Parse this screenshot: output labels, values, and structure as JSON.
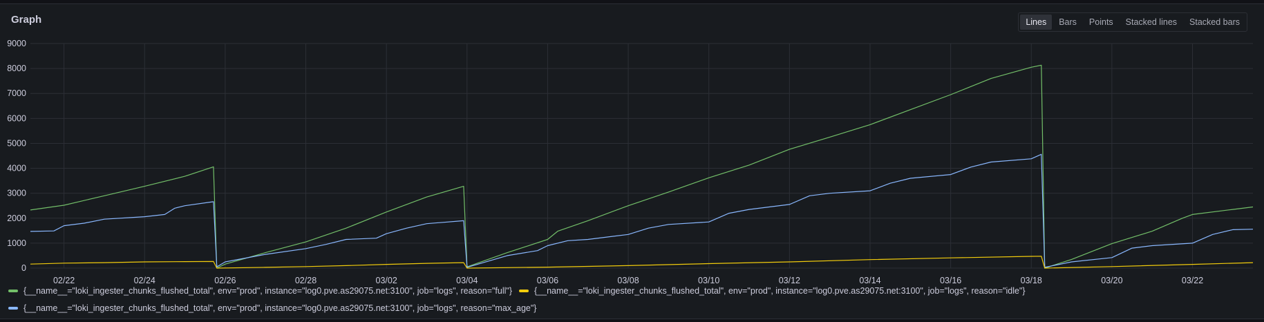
{
  "panel": {
    "title": "Graph",
    "view_modes": [
      "Lines",
      "Bars",
      "Points",
      "Stacked lines",
      "Stacked bars"
    ],
    "active_mode": "Lines"
  },
  "colors": {
    "background": "#181b1f",
    "grid": "#2c2f36",
    "full": "#73bf69",
    "idle": "#f2cc0c",
    "max_age": "#8ab8ff"
  },
  "legend": [
    {
      "key": "full",
      "label": "{__name__=\"loki_ingester_chunks_flushed_total\", env=\"prod\", instance=\"log0.pve.as29075.net:3100\", job=\"logs\", reason=\"full\"}"
    },
    {
      "key": "idle",
      "label": "{__name__=\"loki_ingester_chunks_flushed_total\", env=\"prod\", instance=\"log0.pve.as29075.net:3100\", job=\"logs\", reason=\"idle\"}"
    },
    {
      "key": "max_age",
      "label": "{__name__=\"loki_ingester_chunks_flushed_total\", env=\"prod\", instance=\"log0.pve.as29075.net:3100\", job=\"logs\", reason=\"max_age\"}"
    }
  ],
  "chart_data": {
    "type": "line",
    "title": "",
    "xlabel": "",
    "ylabel": "",
    "x_unit": "date (February–March)",
    "xlim": [
      "02/21 04:00",
      "03/23 12:00"
    ],
    "ylim": [
      0,
      9000
    ],
    "yticks": [
      0,
      1000,
      2000,
      3000,
      4000,
      5000,
      6000,
      7000,
      8000,
      9000
    ],
    "xticks": [
      "02/22",
      "02/24",
      "02/26",
      "02/28",
      "03/02",
      "03/04",
      "03/06",
      "03/08",
      "03/10",
      "03/12",
      "03/14",
      "03/16",
      "03/18",
      "03/20",
      "03/22"
    ],
    "grid": true,
    "legend_position": "bottom",
    "series": [
      {
        "key": "full",
        "segments": [
          [
            [
              "02/21 04:00",
              2330
            ],
            [
              "02/22 00:00",
              2520
            ],
            [
              "02/23 00:00",
              2900
            ],
            [
              "02/24 00:00",
              3280
            ],
            [
              "02/25 00:00",
              3680
            ],
            [
              "02/25 17:00",
              4060
            ]
          ],
          [
            [
              "02/25 19:00",
              0
            ],
            [
              "02/26 00:00",
              160
            ],
            [
              "02/27 00:00",
              620
            ],
            [
              "02/28 00:00",
              1050
            ],
            [
              "03/01 00:00",
              1600
            ],
            [
              "03/02 00:00",
              2250
            ],
            [
              "03/03 00:00",
              2850
            ],
            [
              "03/03 22:00",
              3280
            ]
          ],
          [
            [
              "03/04 00:00",
              50
            ],
            [
              "03/05 00:00",
              620
            ],
            [
              "03/06 00:00",
              1150
            ],
            [
              "03/06 06:00",
              1480
            ],
            [
              "03/07 00:00",
              1900
            ],
            [
              "03/08 00:00",
              2500
            ],
            [
              "03/09 00:00",
              3050
            ],
            [
              "03/10 00:00",
              3620
            ],
            [
              "03/11 00:00",
              4130
            ],
            [
              "03/12 00:00",
              4760
            ],
            [
              "03/13 00:00",
              5250
            ],
            [
              "03/14 00:00",
              5750
            ],
            [
              "03/15 00:00",
              6350
            ],
            [
              "03/16 00:00",
              6950
            ],
            [
              "03/17 00:00",
              7600
            ],
            [
              "03/18 00:00",
              8050
            ],
            [
              "03/18 06:00",
              8130
            ]
          ],
          [
            [
              "03/18 08:00",
              0
            ],
            [
              "03/19 00:00",
              350
            ],
            [
              "03/20 00:00",
              980
            ],
            [
              "03/21 00:00",
              1480
            ],
            [
              "03/21 18:00",
              2000
            ],
            [
              "03/22 00:00",
              2150
            ],
            [
              "03/23 00:00",
              2350
            ],
            [
              "03/23 12:00",
              2450
            ]
          ]
        ]
      },
      {
        "key": "max_age",
        "segments": [
          [
            [
              "02/21 04:00",
              1470
            ],
            [
              "02/21 18:00",
              1490
            ],
            [
              "02/22 00:00",
              1700
            ],
            [
              "02/22 12:00",
              1800
            ],
            [
              "02/23 00:00",
              1960
            ],
            [
              "02/24 00:00",
              2060
            ],
            [
              "02/24 12:00",
              2150
            ],
            [
              "02/24 18:00",
              2400
            ],
            [
              "02/25 00:00",
              2500
            ],
            [
              "02/25 17:00",
              2660
            ]
          ],
          [
            [
              "02/25 19:00",
              50
            ],
            [
              "02/26 00:00",
              250
            ],
            [
              "02/27 00:00",
              550
            ],
            [
              "02/28 00:00",
              780
            ],
            [
              "02/28 12:00",
              950
            ],
            [
              "03/01 00:00",
              1150
            ],
            [
              "03/01 18:00",
              1200
            ],
            [
              "03/02 00:00",
              1380
            ],
            [
              "03/02 12:00",
              1600
            ],
            [
              "03/03 00:00",
              1780
            ],
            [
              "03/03 22:00",
              1900
            ]
          ],
          [
            [
              "03/04 00:00",
              30
            ],
            [
              "03/05 00:00",
              500
            ],
            [
              "03/05 18:00",
              700
            ],
            [
              "03/06 00:00",
              900
            ],
            [
              "03/06 12:00",
              1100
            ],
            [
              "03/07 00:00",
              1150
            ],
            [
              "03/08 00:00",
              1350
            ],
            [
              "03/08 12:00",
              1600
            ],
            [
              "03/09 00:00",
              1750
            ],
            [
              "03/10 00:00",
              1850
            ],
            [
              "03/10 12:00",
              2200
            ],
            [
              "03/11 00:00",
              2350
            ],
            [
              "03/12 00:00",
              2550
            ],
            [
              "03/12 12:00",
              2900
            ],
            [
              "03/13 00:00",
              3000
            ],
            [
              "03/14 00:00",
              3100
            ],
            [
              "03/14 12:00",
              3400
            ],
            [
              "03/15 00:00",
              3600
            ],
            [
              "03/16 00:00",
              3750
            ],
            [
              "03/16 12:00",
              4050
            ],
            [
              "03/17 00:00",
              4250
            ],
            [
              "03/18 00:00",
              4380
            ],
            [
              "03/18 06:00",
              4560
            ]
          ],
          [
            [
              "03/18 08:00",
              30
            ],
            [
              "03/19 00:00",
              250
            ],
            [
              "03/20 00:00",
              420
            ],
            [
              "03/20 12:00",
              800
            ],
            [
              "03/21 00:00",
              900
            ],
            [
              "03/22 00:00",
              1000
            ],
            [
              "03/22 12:00",
              1350
            ],
            [
              "03/23 00:00",
              1540
            ],
            [
              "03/23 12:00",
              1560
            ]
          ]
        ]
      },
      {
        "key": "idle",
        "segments": [
          [
            [
              "02/21 04:00",
              160
            ],
            [
              "02/22 00:00",
              200
            ],
            [
              "02/23 00:00",
              220
            ],
            [
              "02/24 00:00",
              250
            ],
            [
              "02/25 00:00",
              260
            ],
            [
              "02/25 17:00",
              265
            ]
          ],
          [
            [
              "02/25 19:00",
              0
            ],
            [
              "02/27 00:00",
              30
            ],
            [
              "02/28 00:00",
              60
            ],
            [
              "03/01 00:00",
              100
            ],
            [
              "03/02 00:00",
              150
            ],
            [
              "03/03 00:00",
              190
            ],
            [
              "03/03 22:00",
              220
            ]
          ],
          [
            [
              "03/04 00:00",
              0
            ],
            [
              "03/06 00:00",
              40
            ],
            [
              "03/08 00:00",
              100
            ],
            [
              "03/10 00:00",
              180
            ],
            [
              "03/12 00:00",
              250
            ],
            [
              "03/14 00:00",
              340
            ],
            [
              "03/16 00:00",
              410
            ],
            [
              "03/18 00:00",
              470
            ],
            [
              "03/18 06:00",
              475
            ]
          ],
          [
            [
              "03/18 08:00",
              0
            ],
            [
              "03/20 00:00",
              60
            ],
            [
              "03/22 00:00",
              150
            ],
            [
              "03/23 12:00",
              220
            ]
          ]
        ]
      }
    ]
  }
}
